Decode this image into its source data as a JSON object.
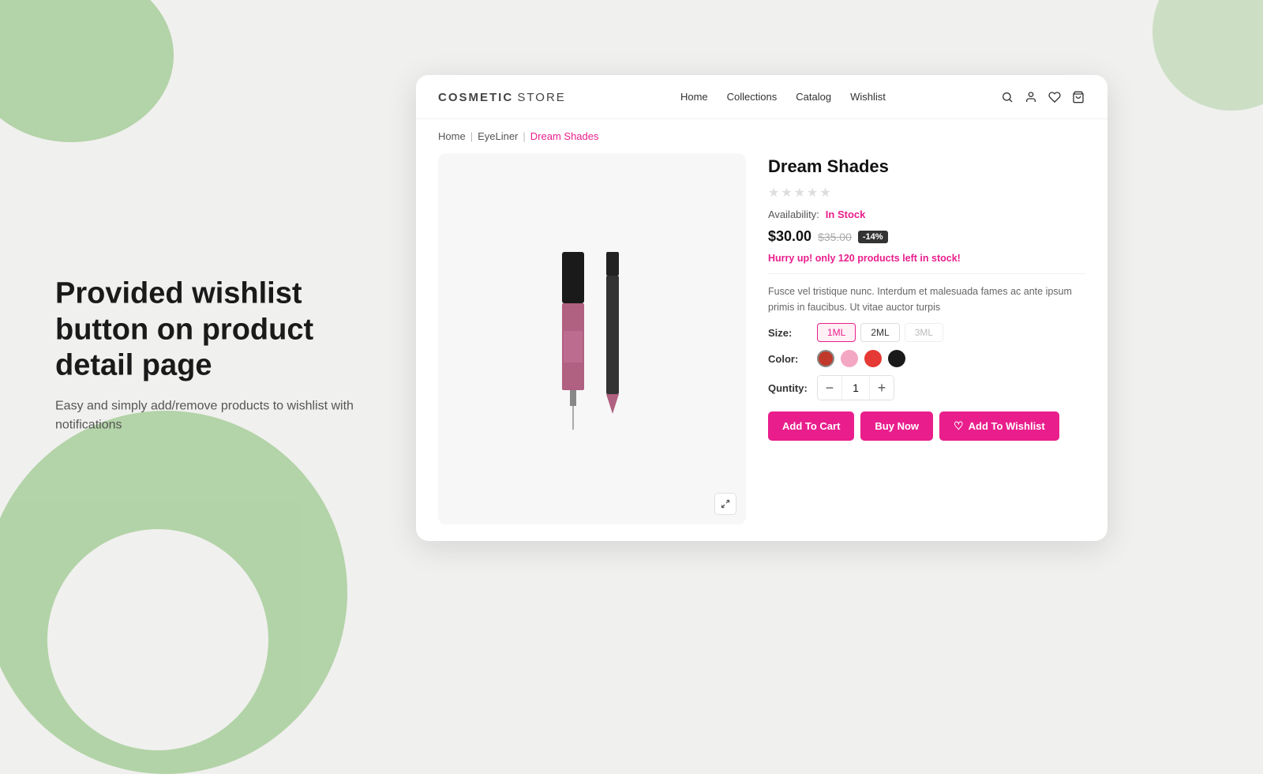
{
  "background": {
    "color": "#f0f0ee",
    "shape_color": "#a8ce9b"
  },
  "promo": {
    "heading": "Provided wishlist button on product detail page",
    "subtext": "Easy and simply add/remove products to wishlist with notifications"
  },
  "header": {
    "logo_bold": "COSMETIC",
    "logo_light": "STORE",
    "nav": [
      "Home",
      "Collections",
      "Catalog",
      "Wishlist"
    ],
    "icons": [
      "search",
      "user",
      "heart",
      "cart"
    ]
  },
  "breadcrumb": {
    "home": "Home",
    "category": "EyeLiner",
    "current": "Dream Shades"
  },
  "product": {
    "title": "Dream Shades",
    "availability_label": "Availability:",
    "availability_value": "In Stock",
    "price_current": "$30.00",
    "price_original": "$35.00",
    "price_badge": "-14%",
    "hurry_text": "Hurry up! only",
    "hurry_count": "120",
    "hurry_suffix": "products left in stock!",
    "description": "Fusce vel tristique nunc. Interdum et malesuada fames ac ante ipsum primis in faucibus. Ut vitae auctor turpis",
    "size_label": "Size:",
    "sizes": [
      {
        "label": "1ML",
        "state": "active"
      },
      {
        "label": "2ML",
        "state": "normal"
      },
      {
        "label": "3ML",
        "state": "muted"
      }
    ],
    "color_label": "Color:",
    "colors": [
      {
        "hex": "#c0392b",
        "selected": true
      },
      {
        "hex": "#f4a7c3",
        "selected": false
      },
      {
        "hex": "#e53935",
        "selected": false
      },
      {
        "hex": "#1a1a1a",
        "selected": false
      }
    ],
    "quantity_label": "Quntity:",
    "quantity_value": "1",
    "btn_cart": "Add To Cart",
    "btn_buy": "Buy Now",
    "btn_wishlist": "Add To Wishlist"
  }
}
